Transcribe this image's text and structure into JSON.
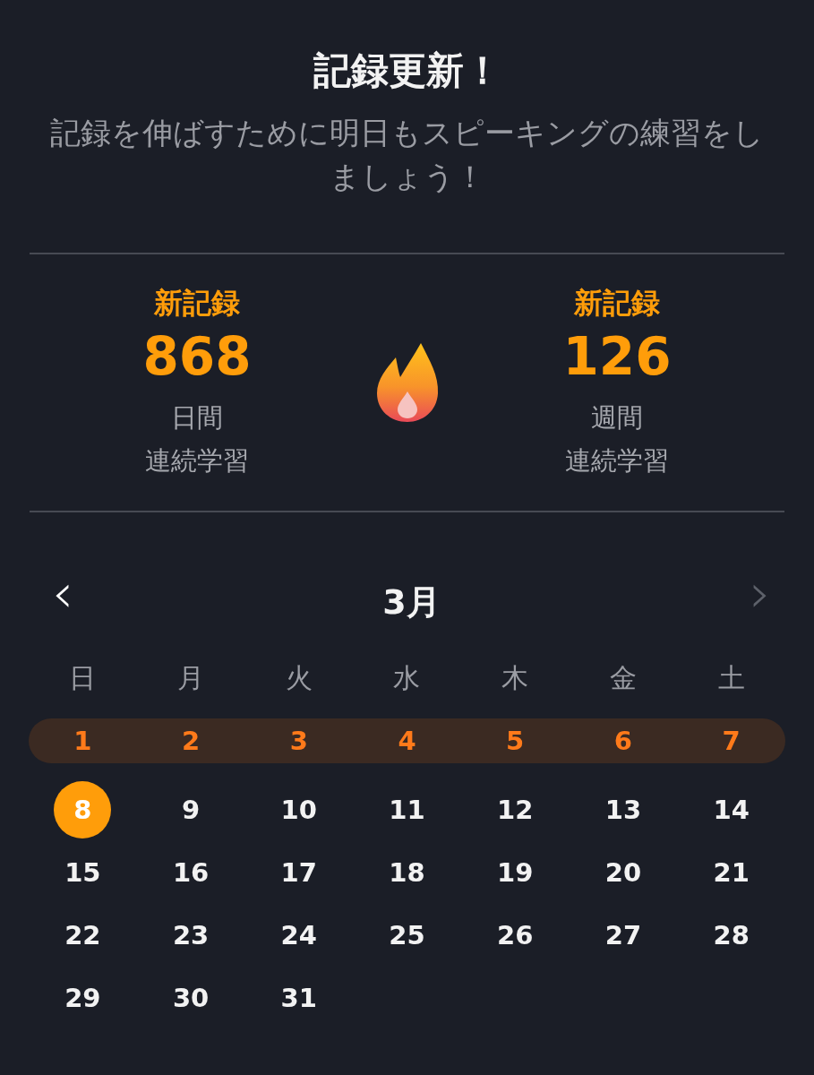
{
  "header": {
    "title": "記録更新！",
    "subtitle": "記録を伸ばすために明日もスピーキングの練習をしましょう！"
  },
  "stats": [
    {
      "badge": "新記録",
      "value": "868",
      "unit": "日間",
      "label": "連続学習"
    },
    {
      "badge": "新記録",
      "value": "126",
      "unit": "週間",
      "label": "連続学習"
    }
  ],
  "calendar": {
    "month": "3月",
    "prev": {
      "label": "‹",
      "disabled": false
    },
    "next": {
      "label": "›",
      "disabled": true
    },
    "weekdays": [
      "日",
      "月",
      "火",
      "水",
      "木",
      "金",
      "土"
    ],
    "weeks": [
      {
        "highlighted": true,
        "days": [
          {
            "label": "1",
            "selected": false
          },
          {
            "label": "2",
            "selected": false
          },
          {
            "label": "3",
            "selected": false
          },
          {
            "label": "4",
            "selected": false
          },
          {
            "label": "5",
            "selected": false
          },
          {
            "label": "6",
            "selected": false
          },
          {
            "label": "7",
            "selected": false
          }
        ]
      },
      {
        "highlighted": false,
        "days": [
          {
            "label": "8",
            "selected": true
          },
          {
            "label": "9",
            "selected": false
          },
          {
            "label": "10",
            "selected": false
          },
          {
            "label": "11",
            "selected": false
          },
          {
            "label": "12",
            "selected": false
          },
          {
            "label": "13",
            "selected": false
          },
          {
            "label": "14",
            "selected": false
          }
        ]
      },
      {
        "highlighted": false,
        "days": [
          {
            "label": "15",
            "selected": false
          },
          {
            "label": "16",
            "selected": false
          },
          {
            "label": "17",
            "selected": false
          },
          {
            "label": "18",
            "selected": false
          },
          {
            "label": "19",
            "selected": false
          },
          {
            "label": "20",
            "selected": false
          },
          {
            "label": "21",
            "selected": false
          }
        ]
      },
      {
        "highlighted": false,
        "days": [
          {
            "label": "22",
            "selected": false
          },
          {
            "label": "23",
            "selected": false
          },
          {
            "label": "24",
            "selected": false
          },
          {
            "label": "25",
            "selected": false
          },
          {
            "label": "26",
            "selected": false
          },
          {
            "label": "27",
            "selected": false
          },
          {
            "label": "28",
            "selected": false
          }
        ]
      },
      {
        "highlighted": false,
        "days": [
          {
            "label": "29",
            "selected": false
          },
          {
            "label": "30",
            "selected": false
          },
          {
            "label": "31",
            "selected": false
          }
        ]
      }
    ]
  }
}
